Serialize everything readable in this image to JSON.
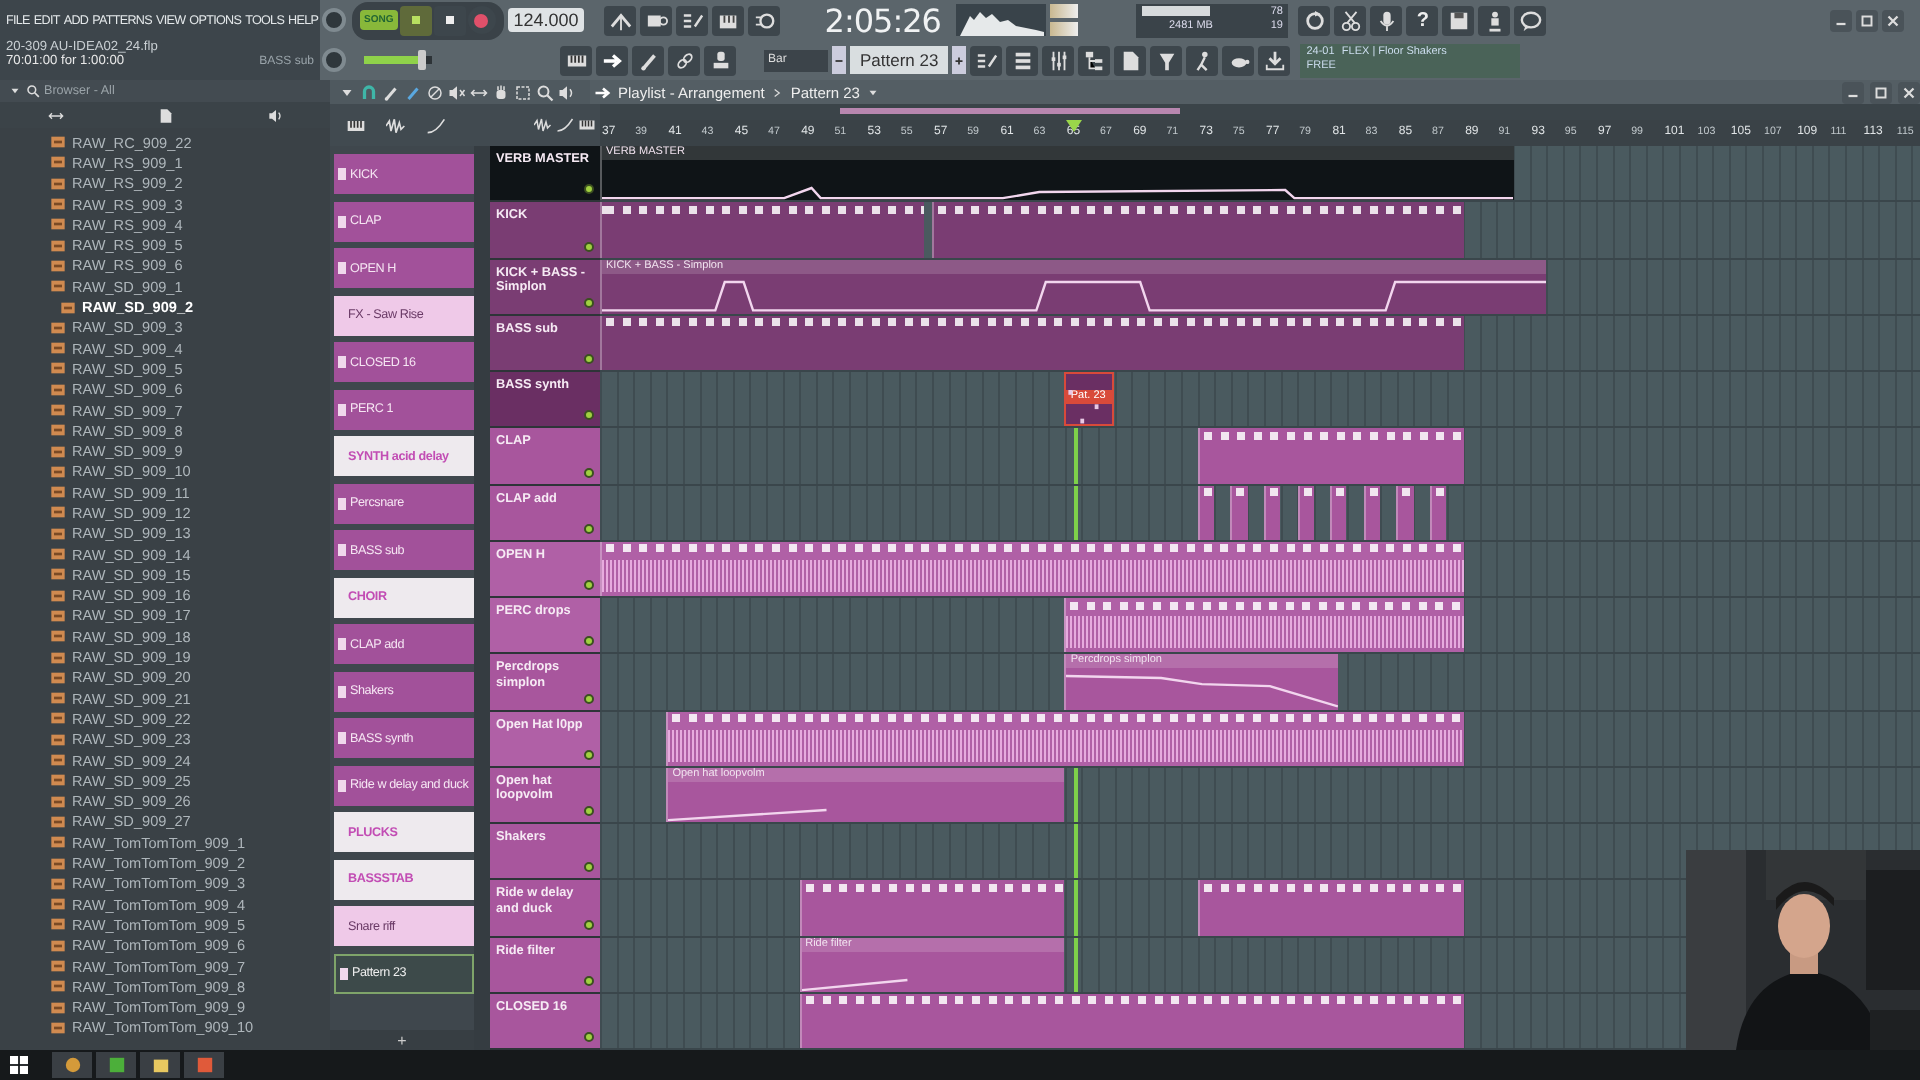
{
  "menu": [
    "FILE",
    "EDIT",
    "ADD",
    "PATTERNS",
    "VIEW",
    "OPTIONS",
    "TOOLS",
    "HELP"
  ],
  "file_info": {
    "name": "20-309 AU-IDEA02_24.flp",
    "time": "70:01:00 for 1:00:00",
    "channel": "BASS sub"
  },
  "transport": {
    "mode": "SONG",
    "tempo": "124.000",
    "master_volume": {
      "level": 0.85
    }
  },
  "clock": "2:05:26",
  "cpu": {
    "cpu": "78",
    "memory": "2481 MB",
    "polyphony": "19"
  },
  "help": "?",
  "snap": "Bar",
  "pattern_selector": "Pattern 23",
  "news": {
    "date": "24-01",
    "title": "FLEX | Floor Shakers",
    "tag": "FREE"
  },
  "browser": {
    "title": "Browser - All",
    "items": [
      {
        "label": "RAW_RC_909_22",
        "selected": false
      },
      {
        "label": "RAW_RS_909_1",
        "selected": false
      },
      {
        "label": "RAW_RS_909_2",
        "selected": false
      },
      {
        "label": "RAW_RS_909_3",
        "selected": false
      },
      {
        "label": "RAW_RS_909_4",
        "selected": false
      },
      {
        "label": "RAW_RS_909_5",
        "selected": false
      },
      {
        "label": "RAW_RS_909_6",
        "selected": false
      },
      {
        "label": "RAW_SD_909_1",
        "selected": false
      },
      {
        "label": "RAW_SD_909_2",
        "selected": true
      },
      {
        "label": "RAW_SD_909_3",
        "selected": false
      },
      {
        "label": "RAW_SD_909_4",
        "selected": false
      },
      {
        "label": "RAW_SD_909_5",
        "selected": false
      },
      {
        "label": "RAW_SD_909_6",
        "selected": false
      },
      {
        "label": "RAW_SD_909_7",
        "selected": false
      },
      {
        "label": "RAW_SD_909_8",
        "selected": false
      },
      {
        "label": "RAW_SD_909_9",
        "selected": false
      },
      {
        "label": "RAW_SD_909_10",
        "selected": false
      },
      {
        "label": "RAW_SD_909_11",
        "selected": false
      },
      {
        "label": "RAW_SD_909_12",
        "selected": false
      },
      {
        "label": "RAW_SD_909_13",
        "selected": false
      },
      {
        "label": "RAW_SD_909_14",
        "selected": false
      },
      {
        "label": "RAW_SD_909_15",
        "selected": false
      },
      {
        "label": "RAW_SD_909_16",
        "selected": false
      },
      {
        "label": "RAW_SD_909_17",
        "selected": false
      },
      {
        "label": "RAW_SD_909_18",
        "selected": false
      },
      {
        "label": "RAW_SD_909_19",
        "selected": false
      },
      {
        "label": "RAW_SD_909_20",
        "selected": false
      },
      {
        "label": "RAW_SD_909_21",
        "selected": false
      },
      {
        "label": "RAW_SD_909_22",
        "selected": false
      },
      {
        "label": "RAW_SD_909_23",
        "selected": false
      },
      {
        "label": "RAW_SD_909_24",
        "selected": false
      },
      {
        "label": "RAW_SD_909_25",
        "selected": false
      },
      {
        "label": "RAW_SD_909_26",
        "selected": false
      },
      {
        "label": "RAW_SD_909_27",
        "selected": false
      },
      {
        "label": "RAW_TomTomTom_909_1",
        "selected": false
      },
      {
        "label": "RAW_TomTomTom_909_2",
        "selected": false
      },
      {
        "label": "RAW_TomTomTom_909_3",
        "selected": false
      },
      {
        "label": "RAW_TomTomTom_909_4",
        "selected": false
      },
      {
        "label": "RAW_TomTomTom_909_5",
        "selected": false
      },
      {
        "label": "RAW_TomTomTom_909_6",
        "selected": false
      },
      {
        "label": "RAW_TomTomTom_909_7",
        "selected": false
      },
      {
        "label": "RAW_TomTomTom_909_8",
        "selected": false
      },
      {
        "label": "RAW_TomTomTom_909_9",
        "selected": false
      },
      {
        "label": "RAW_TomTomTom_909_10",
        "selected": false
      }
    ]
  },
  "channel_rack": {
    "items": [
      {
        "label": "KICK",
        "kind": "pattern",
        "selected": false
      },
      {
        "label": "CLAP",
        "kind": "pattern",
        "selected": false
      },
      {
        "label": "OPEN H",
        "kind": "pattern",
        "selected": false
      },
      {
        "label": "FX - Saw Rise",
        "kind": "automation",
        "selected": false
      },
      {
        "label": "CLOSED 16",
        "kind": "pattern",
        "selected": false
      },
      {
        "label": "PERC 1",
        "kind": "pattern",
        "selected": false
      },
      {
        "label": "SYNTH acid delay",
        "kind": "audio",
        "selected": false
      },
      {
        "label": "Percsnare",
        "kind": "pattern",
        "selected": false
      },
      {
        "label": "BASS sub",
        "kind": "pattern",
        "selected": false
      },
      {
        "label": "CHOIR",
        "kind": "audio",
        "selected": false
      },
      {
        "label": "CLAP add",
        "kind": "pattern",
        "selected": false
      },
      {
        "label": "Shakers",
        "kind": "pattern",
        "selected": false
      },
      {
        "label": "BASS synth",
        "kind": "pattern",
        "selected": false
      },
      {
        "label": "Ride w delay and duck",
        "kind": "pattern",
        "selected": false
      },
      {
        "label": "PLUCKS",
        "kind": "audio",
        "selected": false
      },
      {
        "label": "BASSSTAB",
        "kind": "audio",
        "selected": false
      },
      {
        "label": "Snare riff",
        "kind": "automation",
        "selected": false
      },
      {
        "label": "Pattern 23",
        "kind": "pattern",
        "selected": true
      }
    ],
    "add_button": "+"
  },
  "playlist": {
    "title": "Playlist - Arrangement",
    "pattern": "Pattern 23",
    "ruler": [
      "37",
      "39",
      "41",
      "43",
      "45",
      "47",
      "49",
      "51",
      "53",
      "55",
      "57",
      "59",
      "61",
      "63",
      "65",
      "67",
      "69",
      "71",
      "73",
      "75",
      "77",
      "79",
      "81",
      "83",
      "85",
      "87",
      "89",
      "91",
      "93",
      "95",
      "97",
      "99",
      "101",
      "103",
      "105",
      "107",
      "109",
      "111",
      "113",
      "115"
    ],
    "tracks": [
      {
        "name": "VERB MASTER",
        "color": "#0f1417",
        "clips": [
          {
            "kind": "automation",
            "label": "VERB MASTER",
            "selected": false
          }
        ]
      },
      {
        "name": "KICK",
        "color": "#7a3d73",
        "clips": [
          {
            "kind": "pattern",
            "selected": false
          },
          {
            "kind": "pattern",
            "selected": false
          }
        ]
      },
      {
        "name": "KICK + BASS - Simplon",
        "color": "#7a3d73",
        "clips": [
          {
            "kind": "automation",
            "label": "KICK + BASS - Simplon",
            "selected": false
          }
        ]
      },
      {
        "name": "BASS sub",
        "color": "#7a3d73",
        "clips": [
          {
            "kind": "pattern",
            "selected": false
          }
        ]
      },
      {
        "name": "BASS synth",
        "color": "#6a2f63",
        "clips": [
          {
            "kind": "pattern",
            "label": "Pat. 23",
            "selected": true
          }
        ]
      },
      {
        "name": "CLAP",
        "color": "#a8569d",
        "clips": [
          {
            "kind": "pattern",
            "selected": false
          }
        ]
      },
      {
        "name": "CLAP add",
        "color": "#a8569d",
        "clips": [
          {
            "kind": "pattern",
            "selected": false
          },
          {
            "kind": "pattern",
            "selected": false
          },
          {
            "kind": "pattern",
            "selected": false
          },
          {
            "kind": "pattern",
            "selected": false
          },
          {
            "kind": "pattern",
            "selected": false
          },
          {
            "kind": "pattern",
            "selected": false
          },
          {
            "kind": "pattern",
            "selected": false
          },
          {
            "kind": "pattern",
            "selected": false
          }
        ]
      },
      {
        "name": "OPEN H",
        "color": "#b060a6",
        "clips": [
          {
            "kind": "audio",
            "selected": false
          }
        ]
      },
      {
        "name": "PERC drops",
        "color": "#b060a6",
        "clips": [
          {
            "kind": "audio",
            "selected": false
          }
        ]
      },
      {
        "name": "Percdrops simplon",
        "color": "#a8569d",
        "clips": [
          {
            "kind": "automation",
            "label": "Percdrops simplon",
            "selected": false
          }
        ]
      },
      {
        "name": "Open Hat l0pp",
        "color": "#b060a6",
        "clips": [
          {
            "kind": "audio",
            "selected": false
          }
        ]
      },
      {
        "name": "Open hat loopvolm",
        "color": "#a8569d",
        "clips": [
          {
            "kind": "automation",
            "label": "Open hat loopvolm",
            "selected": false
          }
        ]
      },
      {
        "name": "Shakers",
        "color": "#a8569d"
      },
      {
        "name": "Ride w delay and duck",
        "color": "#a8569d",
        "clips": [
          {
            "kind": "pattern",
            "selected": false
          },
          {
            "kind": "pattern",
            "selected": false
          }
        ]
      },
      {
        "name": "Ride filter",
        "color": "#a8569d",
        "clips": [
          {
            "kind": "automation",
            "label": "Ride filter",
            "selected": false
          }
        ]
      },
      {
        "name": "CLOSED 16",
        "color": "#a8569d",
        "clips": [
          {
            "kind": "pattern",
            "selected": false
          }
        ]
      }
    ]
  }
}
